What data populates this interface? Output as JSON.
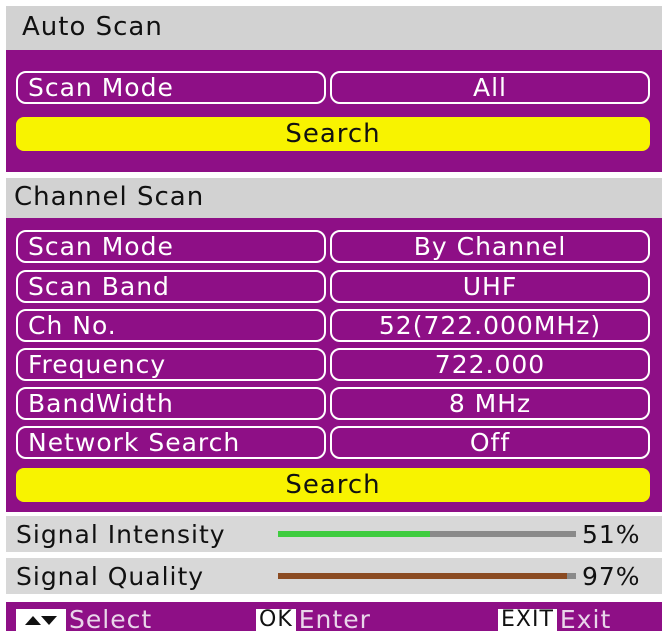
{
  "auto_scan": {
    "title": "Auto Scan",
    "scan_mode_label": "Scan Mode",
    "scan_mode_value": "All",
    "search_label": "Search"
  },
  "channel_scan": {
    "title": "Channel Scan",
    "rows": [
      {
        "label": "Scan Mode",
        "value": "By Channel"
      },
      {
        "label": "Scan Band",
        "value": "UHF"
      },
      {
        "label": "Ch No.",
        "value": "52(722.000MHz)"
      },
      {
        "label": "Frequency",
        "value": "722.000"
      },
      {
        "label": "BandWidth",
        "value": "8 MHz"
      },
      {
        "label": "Network Search",
        "value": "Off"
      }
    ],
    "search_label": "Search"
  },
  "signal": {
    "intensity": {
      "label": "Signal Intensity",
      "percent": 51,
      "percent_text": "51%",
      "color": "#3fcc3f"
    },
    "quality": {
      "label": "Signal Quality",
      "percent": 97,
      "percent_text": "97%",
      "color": "#8b4b22"
    }
  },
  "footer": {
    "select_icon": "up-down-arrows",
    "select_label": "Select",
    "ok_key": "OK",
    "enter_label": "Enter",
    "exit_key": "EXIT",
    "exit_label": "Exit"
  },
  "colors": {
    "panel": "#8e0f86",
    "header": "#d2d2d2",
    "highlight": "#f8f300"
  }
}
